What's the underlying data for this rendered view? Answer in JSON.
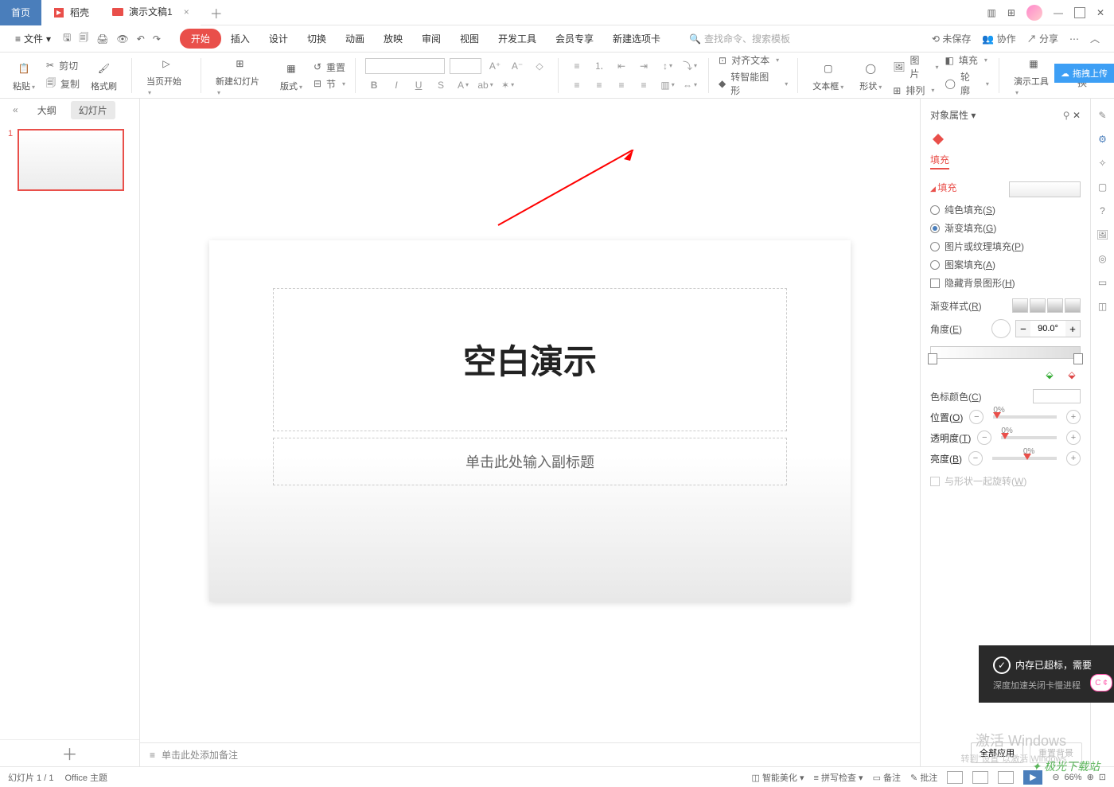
{
  "tabs": {
    "home": "首页",
    "docker": "稻壳",
    "doc": "演示文稿1"
  },
  "menu": {
    "file": "文件"
  },
  "menutabs": [
    "开始",
    "插入",
    "设计",
    "切换",
    "动画",
    "放映",
    "审阅",
    "视图",
    "开发工具",
    "会员专享",
    "新建选项卡"
  ],
  "search_placeholder": "查找命令、搜索模板",
  "rightmenu": {
    "unsaved": "未保存",
    "coop": "协作",
    "share": "分享"
  },
  "ribbon": {
    "paste": "粘贴",
    "cut": "剪切",
    "copy": "复制",
    "format_painter": "格式刷",
    "start_from": "当页开始",
    "new_slide": "新建幻灯片",
    "layout": "版式",
    "section": "节",
    "reset": "重置",
    "align_text": "对齐文本",
    "convert_smart": "转智能图形",
    "textbox": "文本框",
    "shape": "形状",
    "image": "图片",
    "arrange": "排列",
    "fill": "填充",
    "outline": "轮廓",
    "present_tools": "演示工具",
    "replace": "替换"
  },
  "leftpanel": {
    "outline": "大纲",
    "slides": "幻灯片",
    "thumb_num": "1"
  },
  "slide": {
    "title": "空白演示",
    "subtitle": "单击此处输入副标题"
  },
  "notes_placeholder": "单击此处添加备注",
  "props": {
    "header": "对象属性",
    "fill_tab": "填充",
    "fill_section": "填充",
    "solid": "纯色填充(",
    "solid_k": "S",
    "gradient": "渐变填充(",
    "gradient_k": "G",
    "picture": "图片或纹理填充(",
    "picture_k": "P",
    "pattern": "图案填充(",
    "pattern_k": "A",
    "hide_bg": "隐藏背景图形(",
    "hide_bg_k": "H",
    "grad_style": "渐变样式(",
    "grad_style_k": "R",
    "angle": "角度(",
    "angle_k": "E",
    "angle_val": "90.0°",
    "stop_color": "色标颜色(",
    "stop_color_k": "C",
    "position": "位置(",
    "position_k": "O",
    "position_val": "0%",
    "opacity": "透明度(",
    "opacity_k": "T",
    "opacity_val": "0%",
    "brightness": "亮度(",
    "brightness_k": "B",
    "brightness_val": "0%",
    "rotate_with": "与形状一起旋转(",
    "rotate_with_k": "W",
    "apply_all": "全部应用",
    "reset_bg": "重置背景"
  },
  "status": {
    "slide_pos": "幻灯片 1 / 1",
    "theme": "Office 主题",
    "beautify": "智能美化",
    "spell": "拼写检查",
    "notes": "备注",
    "comments": "批注",
    "zoom": "66%"
  },
  "cloud_badge": "拖拽上传",
  "notify": {
    "title": "内存已超标，需要",
    "sub": "深度加速关闭卡慢进程"
  },
  "watermark": "激活 Windows",
  "watermark2": "转到\"设置\"以激活 Windows",
  "logo": "极光下载站",
  "cc": "C ¢"
}
